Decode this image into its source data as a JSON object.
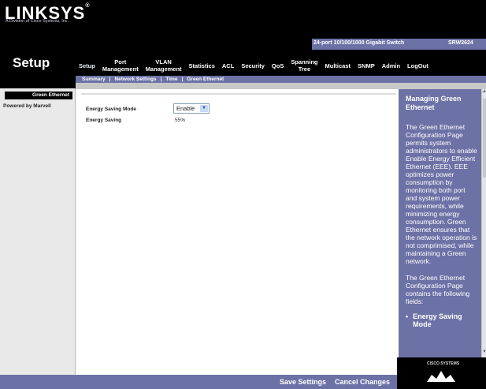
{
  "brand": {
    "logo": "LINKSYS",
    "trademark": "®",
    "subtitle": "A Division of Cisco Systems, Inc."
  },
  "section_title": "Setup",
  "device": {
    "description": "24-port 10/100/1000 Gigabit Switch",
    "model": "SRW2624"
  },
  "tabs": [
    {
      "label": "Setup"
    },
    {
      "label": "Port\nManagement"
    },
    {
      "label": "VLAN\nManagement"
    },
    {
      "label": "Statistics"
    },
    {
      "label": "ACL"
    },
    {
      "label": "Security"
    },
    {
      "label": "QoS"
    },
    {
      "label": "Spanning\nTree"
    },
    {
      "label": "Multicast"
    },
    {
      "label": "SNMP"
    },
    {
      "label": "Admin"
    },
    {
      "label": "LogOut"
    }
  ],
  "subtabs": [
    {
      "label": "Summary"
    },
    {
      "label": "Network Settings"
    },
    {
      "label": "Time"
    },
    {
      "label": "Green Ethernet"
    }
  ],
  "sidebar": {
    "badge": "Green Ethernet",
    "powered_by": "Powered by Marvell"
  },
  "form": {
    "mode_label": "Energy Saving Mode",
    "mode_value": "Enable",
    "saving_label": "Energy Saving",
    "saving_value": "55%"
  },
  "help": {
    "title": "Managing Green Ethernet",
    "paragraph1": "The Green Ethernet Configuration Page permits system administrators to enable Enable Energy Efficient Ethernet (EEE). EEE optimizes power consumption by monitoring both port and system power requirements, while minimizing energy consumption. Green Ethernet ensures that the network operation is not comprimised, while maintaining a Green network.",
    "paragraph2": "The Green Ethernet Configuration Page contains the following fields:",
    "bullet": "Energy Saving Mode"
  },
  "footer": {
    "save": "Save Settings",
    "cancel": "Cancel Changes",
    "cisco": "CISCO SYSTEMS"
  },
  "colors": {
    "brand_purple": "#6c72a6",
    "header_black": "#000000",
    "left_gray": "#e9e9e9"
  }
}
